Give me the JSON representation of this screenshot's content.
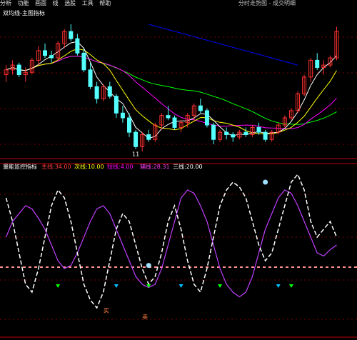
{
  "menu": {
    "items": [
      "分析",
      "功能",
      "画面",
      "线",
      "选股",
      "工具",
      "帮助"
    ],
    "right_text": "分时走势图 - 成交明细"
  },
  "upper_panel": {
    "title": "双均线-主图指标",
    "price_label_left": "11",
    "colors": {
      "up_candle": "#ff3030",
      "down_candle": "#54ffff",
      "ma_fast": "#ffffff",
      "ma_mid": "#ffff00",
      "ma_slow": "#ff00ff",
      "ma_long": "#00ff00",
      "ma_extra": "#0000ff",
      "ref_line": "#ff3030"
    }
  },
  "lower_panel": {
    "title": "量能监控指标",
    "legend": [
      {
        "label": "主线",
        "value": "34.00",
        "color": "#ff4040"
      },
      {
        "label": "次线",
        "value": "10.00",
        "color": "#ffff00"
      },
      {
        "label": "短线",
        "value": "4.00",
        "color": "#ff00ff"
      },
      {
        "label": "辅线",
        "value": "28.31",
        "color": "#ff40ff"
      },
      {
        "label": "三线",
        "value": "20.00",
        "color": "#ffffff"
      }
    ],
    "markers": [
      "买",
      "卖"
    ]
  },
  "chart_data": [
    {
      "type": "candlestick",
      "candles": [
        [
          12.2,
          12.6,
          11.9,
          12.4
        ],
        [
          12.4,
          12.8,
          12.2,
          12.6
        ],
        [
          12.6,
          12.7,
          12.1,
          12.2
        ],
        [
          12.2,
          12.5,
          11.9,
          12.3
        ],
        [
          12.3,
          12.9,
          12.2,
          12.8
        ],
        [
          12.8,
          13.4,
          12.6,
          13.2
        ],
        [
          13.2,
          13.5,
          12.9,
          13.0
        ],
        [
          13.0,
          13.2,
          12.7,
          12.9
        ],
        [
          12.9,
          13.6,
          12.8,
          13.5
        ],
        [
          13.5,
          14.1,
          13.3,
          14.0
        ],
        [
          14.0,
          14.3,
          13.6,
          13.7
        ],
        [
          13.7,
          13.9,
          13.0,
          13.1
        ],
        [
          13.1,
          13.3,
          12.3,
          12.4
        ],
        [
          12.4,
          12.7,
          11.6,
          11.7
        ],
        [
          11.7,
          11.9,
          11.0,
          11.2
        ],
        [
          11.2,
          11.8,
          11.1,
          11.7
        ],
        [
          11.7,
          11.9,
          11.2,
          11.3
        ],
        [
          11.3,
          11.4,
          10.4,
          10.6
        ],
        [
          10.6,
          10.9,
          10.2,
          10.4
        ],
        [
          10.4,
          10.6,
          9.6,
          9.8
        ],
        [
          9.8,
          9.9,
          9.1,
          9.2
        ],
        [
          9.2,
          9.8,
          9.0,
          9.7
        ],
        [
          9.7,
          9.9,
          9.4,
          9.5
        ],
        [
          9.5,
          10.2,
          9.4,
          10.1
        ],
        [
          10.1,
          10.6,
          9.9,
          10.5
        ],
        [
          10.5,
          10.9,
          10.3,
          10.4
        ],
        [
          10.4,
          10.5,
          9.9,
          10.0
        ],
        [
          10.0,
          10.3,
          9.8,
          10.2
        ],
        [
          10.2,
          10.6,
          10.0,
          10.5
        ],
        [
          10.5,
          11.0,
          10.3,
          10.9
        ],
        [
          10.9,
          11.2,
          10.6,
          10.7
        ],
        [
          10.7,
          10.8,
          10.0,
          10.1
        ],
        [
          10.1,
          10.2,
          9.3,
          9.5
        ],
        [
          9.5,
          9.9,
          9.4,
          9.8
        ],
        [
          9.8,
          10.0,
          9.5,
          9.7
        ],
        [
          9.7,
          9.8,
          9.4,
          9.6
        ],
        [
          9.6,
          9.9,
          9.5,
          9.8
        ],
        [
          9.8,
          10.0,
          9.6,
          9.7
        ],
        [
          9.7,
          10.1,
          9.6,
          10.0
        ],
        [
          10.0,
          10.2,
          9.7,
          9.8
        ],
        [
          9.8,
          9.9,
          9.4,
          9.5
        ],
        [
          9.5,
          9.9,
          9.4,
          9.8
        ],
        [
          9.8,
          10.2,
          9.7,
          10.1
        ],
        [
          10.1,
          10.5,
          10.0,
          10.4
        ],
        [
          10.4,
          10.8,
          10.3,
          10.7
        ],
        [
          10.7,
          11.5,
          10.6,
          11.4
        ],
        [
          11.4,
          12.2,
          11.3,
          12.1
        ],
        [
          12.1,
          12.9,
          11.9,
          12.8
        ],
        [
          12.8,
          13.1,
          12.4,
          12.5
        ],
        [
          12.5,
          12.8,
          12.2,
          12.6
        ],
        [
          12.6,
          13.0,
          12.5,
          12.9
        ],
        [
          12.9,
          14.2,
          12.8,
          14.0
        ]
      ]
    },
    {
      "type": "line",
      "series": [
        {
          "values": [
            60,
            70,
            75,
            80,
            78,
            72,
            65,
            55,
            45,
            40,
            42,
            50,
            60,
            70,
            78,
            80,
            75,
            65,
            55,
            45,
            35,
            30,
            28,
            30,
            40,
            55,
            70,
            85,
            90,
            88,
            80,
            70,
            55,
            40,
            30,
            25,
            22,
            25,
            35,
            50,
            65,
            75,
            85,
            90,
            88,
            80,
            70,
            60,
            50,
            48,
            52,
            55
          ]
        },
        {
          "values": [
            85,
            70,
            50,
            30,
            25,
            40,
            60,
            80,
            90,
            85,
            70,
            50,
            30,
            20,
            15,
            25,
            45,
            65,
            75,
            70,
            55,
            40,
            30,
            35,
            50,
            70,
            80,
            65,
            45,
            30,
            25,
            40,
            60,
            80,
            90,
            95,
            92,
            85,
            70,
            55,
            45,
            50,
            65,
            80,
            95,
            100,
            90,
            70,
            60,
            65,
            70,
            60
          ]
        }
      ],
      "ref_line": 50
    }
  ]
}
